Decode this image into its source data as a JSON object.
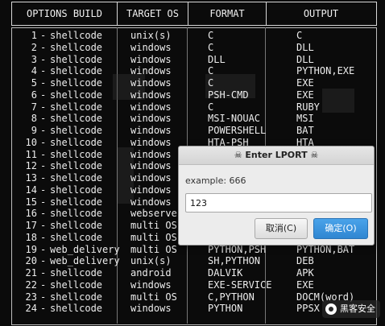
{
  "header": [
    "OPTIONS BUILD",
    "TARGET OS",
    "FORMAT",
    "OUTPUT"
  ],
  "rows": [
    {
      "num": "1",
      "name": "shellcode",
      "os": "unix(s)",
      "fmt": "C",
      "out": "C"
    },
    {
      "num": "2",
      "name": "shellcode",
      "os": "windows",
      "fmt": "C",
      "out": "DLL"
    },
    {
      "num": "3",
      "name": "shellcode",
      "os": "windows",
      "fmt": "DLL",
      "out": "DLL"
    },
    {
      "num": "4",
      "name": "shellcode",
      "os": "windows",
      "fmt": "C",
      "out": "PYTHON,EXE"
    },
    {
      "num": "5",
      "name": "shellcode",
      "os": "windows",
      "fmt": "C",
      "out": "EXE"
    },
    {
      "num": "6",
      "name": "shellcode",
      "os": "windows",
      "fmt": "PSH-CMD",
      "out": "EXE"
    },
    {
      "num": "7",
      "name": "shellcode",
      "os": "windows",
      "fmt": "C",
      "out": "RUBY"
    },
    {
      "num": "8",
      "name": "shellcode",
      "os": "windows",
      "fmt": "MSI-NOUAC",
      "out": "MSI"
    },
    {
      "num": "9",
      "name": "shellcode",
      "os": "windows",
      "fmt": "POWERSHELL",
      "out": "BAT"
    },
    {
      "num": "10",
      "name": "shellcode",
      "os": "windows",
      "fmt": "HTA-PSH",
      "out": "HTA"
    },
    {
      "num": "11",
      "name": "shellcode",
      "os": "windows",
      "fmt": "",
      "out": ""
    },
    {
      "num": "12",
      "name": "shellcode",
      "os": "windows",
      "fmt": "",
      "out": ""
    },
    {
      "num": "13",
      "name": "shellcode",
      "os": "windows",
      "fmt": "",
      "out": ""
    },
    {
      "num": "14",
      "name": "shellcode",
      "os": "windows",
      "fmt": "",
      "out": ""
    },
    {
      "num": "15",
      "name": "shellcode",
      "os": "windows",
      "fmt": "",
      "out": ""
    },
    {
      "num": "16",
      "name": "shellcode",
      "os": "webserver",
      "fmt": "",
      "out": ""
    },
    {
      "num": "17",
      "name": "shellcode",
      "os": "multi OS",
      "fmt": "",
      "out": ""
    },
    {
      "num": "18",
      "name": "shellcode",
      "os": "multi OS",
      "fmt": "",
      "out": ""
    },
    {
      "num": "19",
      "name": "web_delivery",
      "os": "multi OS",
      "fmt": "PYTHON,PSH",
      "out": "PYTHON,BAT"
    },
    {
      "num": "20",
      "name": "web_delivery",
      "os": "unix(s)",
      "fmt": "SH,PYTHON",
      "out": "DEB"
    },
    {
      "num": "21",
      "name": "shellcode",
      "os": "android",
      "fmt": "DALVIK",
      "out": "APK"
    },
    {
      "num": "22",
      "name": "shellcode",
      "os": "windows",
      "fmt": "EXE-SERVICE",
      "out": "EXE"
    },
    {
      "num": "23",
      "name": "shellcode",
      "os": "multi OS",
      "fmt": "C,PYTHON",
      "out": "DOCM(word)"
    },
    {
      "num": "24",
      "name": "shellcode",
      "os": "windows",
      "fmt": "PYTHON",
      "out": "PPSX"
    }
  ],
  "dialog": {
    "title": "☠ Enter LPORT ☠",
    "label": "example: 666",
    "value": "123",
    "cancel": "取消(C)",
    "ok": "确定(O)"
  },
  "watermark": "黑客安全"
}
